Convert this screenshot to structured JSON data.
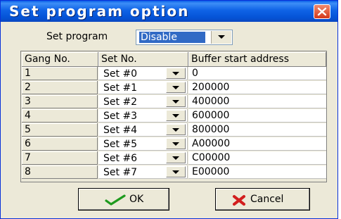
{
  "window": {
    "title": "Set program option"
  },
  "set_program": {
    "label": "Set program",
    "selected": "Disable"
  },
  "columns": [
    "Gang No.",
    "Set No.",
    "Buffer start address"
  ],
  "rows": [
    {
      "gang": "1",
      "set": "Set #0",
      "address": "0"
    },
    {
      "gang": "2",
      "set": "Set #1",
      "address": "200000"
    },
    {
      "gang": "3",
      "set": "Set #2",
      "address": "400000"
    },
    {
      "gang": "4",
      "set": "Set #3",
      "address": "600000"
    },
    {
      "gang": "5",
      "set": "Set #4",
      "address": "800000"
    },
    {
      "gang": "6",
      "set": "Set #5",
      "address": "A00000"
    },
    {
      "gang": "7",
      "set": "Set #6",
      "address": "C00000"
    },
    {
      "gang": "8",
      "set": "Set #7",
      "address": "E00000"
    }
  ],
  "buttons": {
    "ok_label": "OK",
    "cancel_label": "Cancel"
  },
  "icons": {
    "ok": "checkmark-icon",
    "cancel": "cross-icon",
    "close": "close-icon",
    "dropdown": "chevron-down-icon"
  },
  "colors": {
    "titlebar": "#0553d6",
    "close": "#d4391b",
    "selection": "#316ac5",
    "ok_icon": "#1e9a1e",
    "cancel_icon": "#d21e1e"
  }
}
